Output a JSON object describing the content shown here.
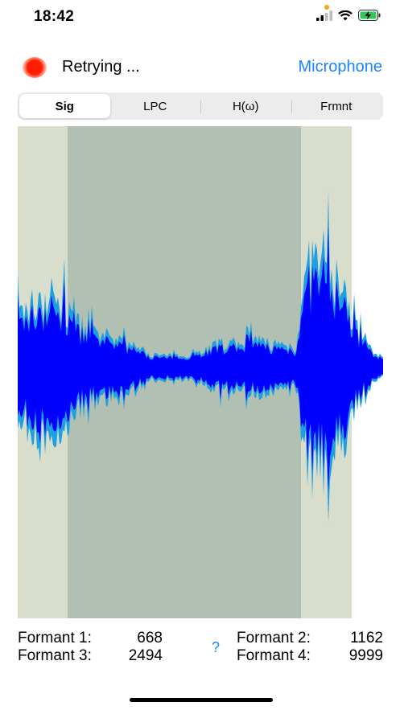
{
  "status_bar": {
    "time": "18:42"
  },
  "header": {
    "status_text": "Retrying ...",
    "source_button": "Microphone"
  },
  "tabs": [
    {
      "label": "Sig",
      "active": true
    },
    {
      "label": "LPC",
      "active": false
    },
    {
      "label": "H(ω)",
      "active": false
    },
    {
      "label": "Frmnt",
      "active": false
    }
  ],
  "waveform": {
    "background_color": "#d9ddcc",
    "selection_color": "#b1c0b2",
    "wave_color": "#0000ff",
    "wave_edge_color": "#1ea0e0"
  },
  "formants": {
    "f1_label": "Formant 1:",
    "f1_value": "668",
    "f2_label": "Formant 2:",
    "f2_value": "1162",
    "f3_label": "Formant 3:",
    "f3_value": "2494",
    "f4_label": "Formant 4:",
    "f4_value": "9999",
    "help": "?"
  }
}
